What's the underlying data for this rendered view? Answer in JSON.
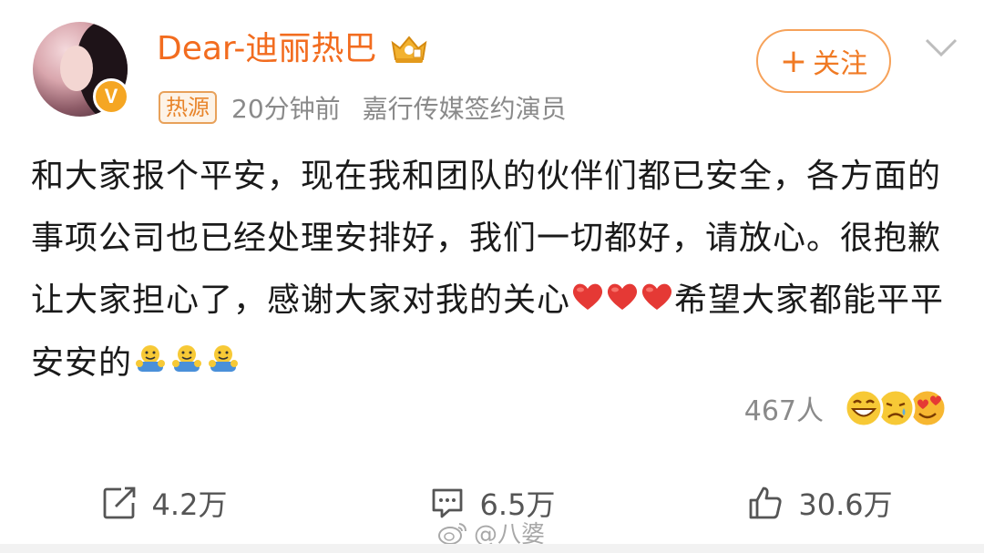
{
  "header": {
    "username": "Dear-迪丽热巴",
    "hot_tag": "热源",
    "time": "20分钟前",
    "description": "嘉行传媒签约演员",
    "follow_plus": "+",
    "follow_label": "关注",
    "verified_badge": "V"
  },
  "post": {
    "text_part1": "和大家报个平安，现在我和团队的伙伴们都已安全，各方面的事项公司也已经处理安排好，我们一切都好，请放心。很抱歉让大家担心了，感谢大家对我的关心",
    "hearts": [
      "heart-emoji",
      "heart-emoji",
      "heart-emoji"
    ],
    "text_part2": "希望大家都能平平安安的",
    "hug_emojis": [
      "hug-emoji",
      "hug-emoji",
      "hug-emoji"
    ]
  },
  "reactions": {
    "count": "467人",
    "icons": [
      "laugh-icon",
      "sad-icon",
      "heart-eyes-icon"
    ]
  },
  "actions": {
    "repost": "4.2万",
    "comment": "6.5万",
    "like": "30.6万"
  },
  "watermark": {
    "text": "@八婆"
  },
  "colors": {
    "brand_orange": "#f26c1f",
    "text": "#1a1a1a",
    "muted": "#8a8a8a",
    "heart": "#e53935"
  }
}
